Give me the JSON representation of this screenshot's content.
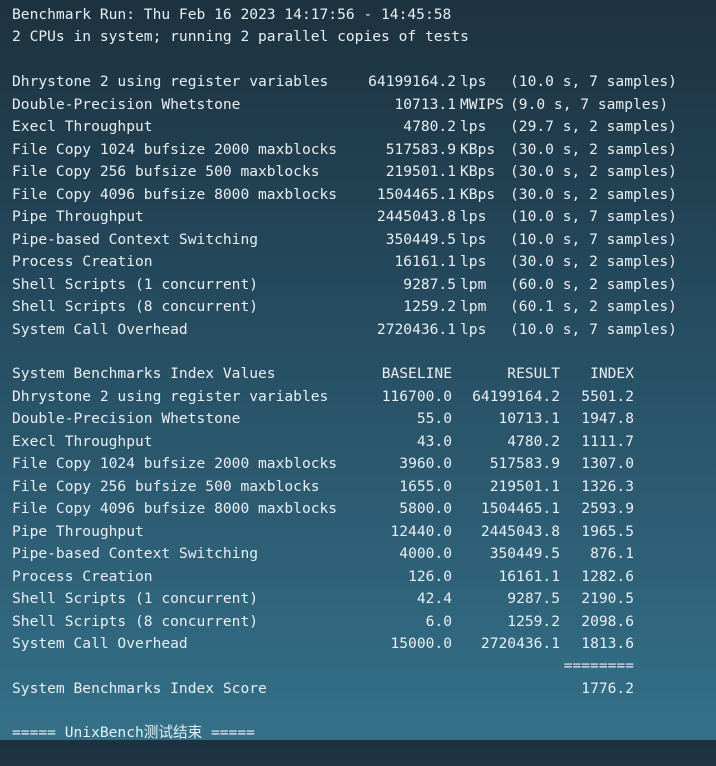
{
  "header": {
    "run_line": "Benchmark Run: Thu Feb 16 2023 14:17:56 - 14:45:58",
    "cpu_line": "2 CPUs in system; running 2 parallel copies of tests"
  },
  "results": [
    {
      "name": "Dhrystone 2 using register variables",
      "value": "64199164.2",
      "unit": "lps",
      "detail": "(10.0 s, 7 samples)"
    },
    {
      "name": "Double-Precision Whetstone",
      "value": "10713.1",
      "unit": "MWIPS",
      "detail": "(9.0 s, 7 samples)"
    },
    {
      "name": "Execl Throughput",
      "value": "4780.2",
      "unit": "lps",
      "detail": "(29.7 s, 2 samples)"
    },
    {
      "name": "File Copy 1024 bufsize 2000 maxblocks",
      "value": "517583.9",
      "unit": "KBps",
      "detail": "(30.0 s, 2 samples)"
    },
    {
      "name": "File Copy 256 bufsize 500 maxblocks",
      "value": "219501.1",
      "unit": "KBps",
      "detail": "(30.0 s, 2 samples)"
    },
    {
      "name": "File Copy 4096 bufsize 8000 maxblocks",
      "value": "1504465.1",
      "unit": "KBps",
      "detail": "(30.0 s, 2 samples)"
    },
    {
      "name": "Pipe Throughput",
      "value": "2445043.8",
      "unit": "lps",
      "detail": "(10.0 s, 7 samples)"
    },
    {
      "name": "Pipe-based Context Switching",
      "value": "350449.5",
      "unit": "lps",
      "detail": "(10.0 s, 7 samples)"
    },
    {
      "name": "Process Creation",
      "value": "16161.1",
      "unit": "lps",
      "detail": "(30.0 s, 2 samples)"
    },
    {
      "name": "Shell Scripts (1 concurrent)",
      "value": "9287.5",
      "unit": "lpm",
      "detail": "(60.0 s, 2 samples)"
    },
    {
      "name": "Shell Scripts (8 concurrent)",
      "value": "1259.2",
      "unit": "lpm",
      "detail": "(60.1 s, 2 samples)"
    },
    {
      "name": "System Call Overhead",
      "value": "2720436.1",
      "unit": "lps",
      "detail": "(10.0 s, 7 samples)"
    }
  ],
  "index_table": {
    "title": "System Benchmarks Index Values",
    "col_baseline": "BASELINE",
    "col_result": "RESULT",
    "col_index": "INDEX",
    "rows": [
      {
        "name": "Dhrystone 2 using register variables",
        "baseline": "116700.0",
        "result": "64199164.2",
        "index": "5501.2"
      },
      {
        "name": "Double-Precision Whetstone",
        "baseline": "55.0",
        "result": "10713.1",
        "index": "1947.8"
      },
      {
        "name": "Execl Throughput",
        "baseline": "43.0",
        "result": "4780.2",
        "index": "1111.7"
      },
      {
        "name": "File Copy 1024 bufsize 2000 maxblocks",
        "baseline": "3960.0",
        "result": "517583.9",
        "index": "1307.0"
      },
      {
        "name": "File Copy 256 bufsize 500 maxblocks",
        "baseline": "1655.0",
        "result": "219501.1",
        "index": "1326.3"
      },
      {
        "name": "File Copy 4096 bufsize 8000 maxblocks",
        "baseline": "5800.0",
        "result": "1504465.1",
        "index": "2593.9"
      },
      {
        "name": "Pipe Throughput",
        "baseline": "12440.0",
        "result": "2445043.8",
        "index": "1965.5"
      },
      {
        "name": "Pipe-based Context Switching",
        "baseline": "4000.0",
        "result": "350449.5",
        "index": "876.1"
      },
      {
        "name": "Process Creation",
        "baseline": "126.0",
        "result": "16161.1",
        "index": "1282.6"
      },
      {
        "name": "Shell Scripts (1 concurrent)",
        "baseline": "42.4",
        "result": "9287.5",
        "index": "2190.5"
      },
      {
        "name": "Shell Scripts (8 concurrent)",
        "baseline": "6.0",
        "result": "1259.2",
        "index": "2098.6"
      },
      {
        "name": "System Call Overhead",
        "baseline": "15000.0",
        "result": "2720436.1",
        "index": "1813.6"
      }
    ],
    "separator": "========",
    "score_label": "System Benchmarks Index Score",
    "score_value": "1776.2"
  },
  "footer": {
    "end_line": "===== UnixBench测试结束 ====="
  },
  "colors": {
    "text": "#e8eef2"
  }
}
